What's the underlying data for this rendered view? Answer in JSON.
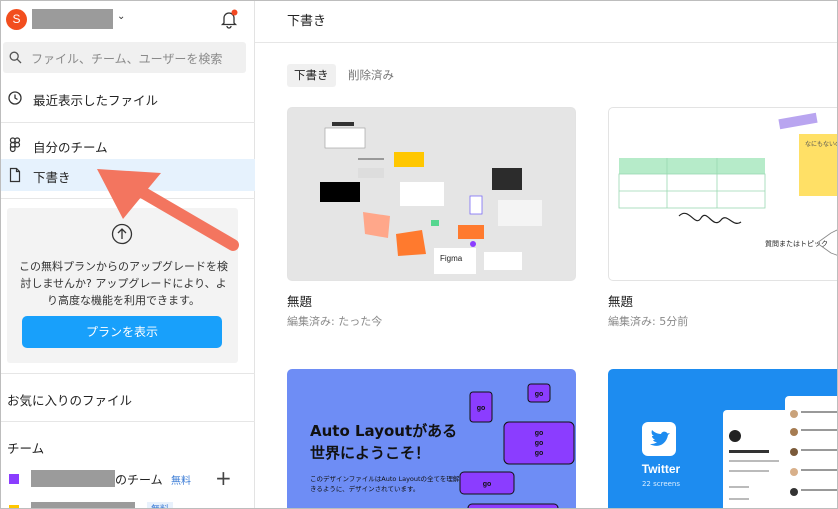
{
  "user": {
    "avatar_letter": "S"
  },
  "search": {
    "placeholder": "ファイル、チーム、ユーザーを検索"
  },
  "nav": {
    "recent": "最近表示したファイル",
    "my_team": "自分のチーム",
    "drafts": "下書き"
  },
  "upgrade": {
    "message": "この無料プランからのアップグレードを検討しませんか? アップグレードにより、より高度な機能を利用できます。",
    "button": "プランを表示"
  },
  "sections": {
    "favorites": "お気に入りのファイル",
    "team": "チーム"
  },
  "teams": [
    {
      "suffix": "のチーム",
      "badge": "無料",
      "color": "#8b3dff"
    },
    {
      "badge": "無料",
      "color": "#ffc700"
    }
  ],
  "main": {
    "title": "下書き",
    "tabs": [
      "下書き",
      "削除済み"
    ]
  },
  "files": [
    {
      "name": "無題",
      "meta": "編集済み: たった今",
      "thumb_text": "Figma"
    },
    {
      "name": "無題",
      "meta": "編集済み: 5分前",
      "thumb_text": "質問またはトピック",
      "note_text": "なにもないの上に"
    },
    {
      "title": "Auto Layoutがある世界にようこそ！",
      "subtitle": "このデザインファイルはAuto Layoutの全てを理解できるように、デザインされています。",
      "go": "go"
    },
    {
      "title": "Twitter",
      "subtitle": "22 screens"
    }
  ],
  "colors": {
    "accent": "#18a0fb",
    "arrow": "#f3755f",
    "autolayout_bg": "#6e8df5",
    "twitter_bg": "#1d8cf0"
  }
}
